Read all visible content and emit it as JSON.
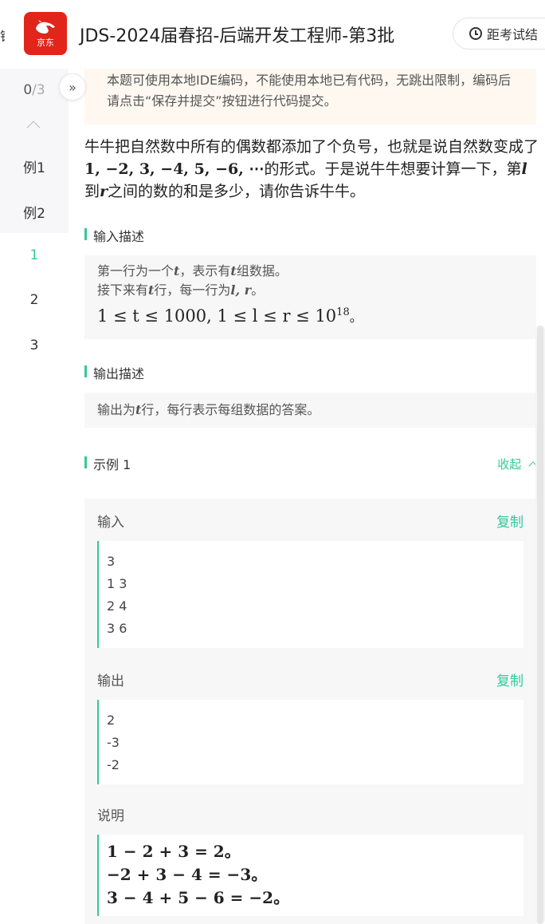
{
  "header": {
    "logo_text": "京东",
    "title": "JDS-2024届春招-后端开发工程师-第3批",
    "exam_button": "距考试结",
    "left_cut": "错"
  },
  "nav": {
    "progress_done": "0",
    "progress_total": "/3",
    "collapse": "»",
    "items": [
      "例1",
      "例2",
      "1",
      "2",
      "3"
    ],
    "active_index": 2
  },
  "notice": {
    "text": "本题可使用本地IDE编码，不能使用本地已有代码，无跳出限制，编码后请点击“保存并提交”按钮进行代码提交。"
  },
  "problem": {
    "p1": "牛牛把自然数中所有的偶数都添加了个负号，也就是说自然数变成了",
    "seq": "1, −2, 3, −4, 5, −6, ⋯",
    "p2": "的形式。于是说牛牛想要计算一下，第",
    "l": "l",
    "p3": "到",
    "r": "r",
    "p4": "之间的数的和是多少，请你告诉牛牛。"
  },
  "input_section": {
    "title": "输入描述",
    "line1_a": "第一行为一个",
    "line1_t": "t",
    "line1_b": "，表示有",
    "line1_t2": "t",
    "line1_c": "组数据。",
    "line2_a": "接下来有",
    "line2_t": "t",
    "line2_b": "行，每一行为",
    "line2_lr": "l, r",
    "line2_c": "。",
    "constraint": "1 ≤ t ≤ 1000, 1 ≤ l ≤ r ≤ 10",
    "constraint_exp": "18",
    "constraint_end": "。"
  },
  "output_section": {
    "title": "输出描述",
    "line_a": "输出为",
    "line_t": "t",
    "line_b": "行，每行表示每组数据的答案。"
  },
  "example": {
    "title": "示例 1",
    "toggle": "收起",
    "input_label": "输入",
    "copy_label": "复制",
    "input_lines": [
      "3",
      "1 3",
      "2 4",
      "3 6"
    ],
    "output_label": "输出",
    "output_lines": [
      "2",
      "-3",
      "-2"
    ],
    "explain_label": "说明",
    "explain_lines": [
      "1 − 2 + 3 = 2。",
      "−2 + 3 − 4 = −3。",
      "3 − 4 + 5 − 6 = −2。"
    ]
  },
  "colors": {
    "accent": "#32ca99",
    "brand": "#e1251b",
    "notice_bg": "#fef8f1"
  }
}
